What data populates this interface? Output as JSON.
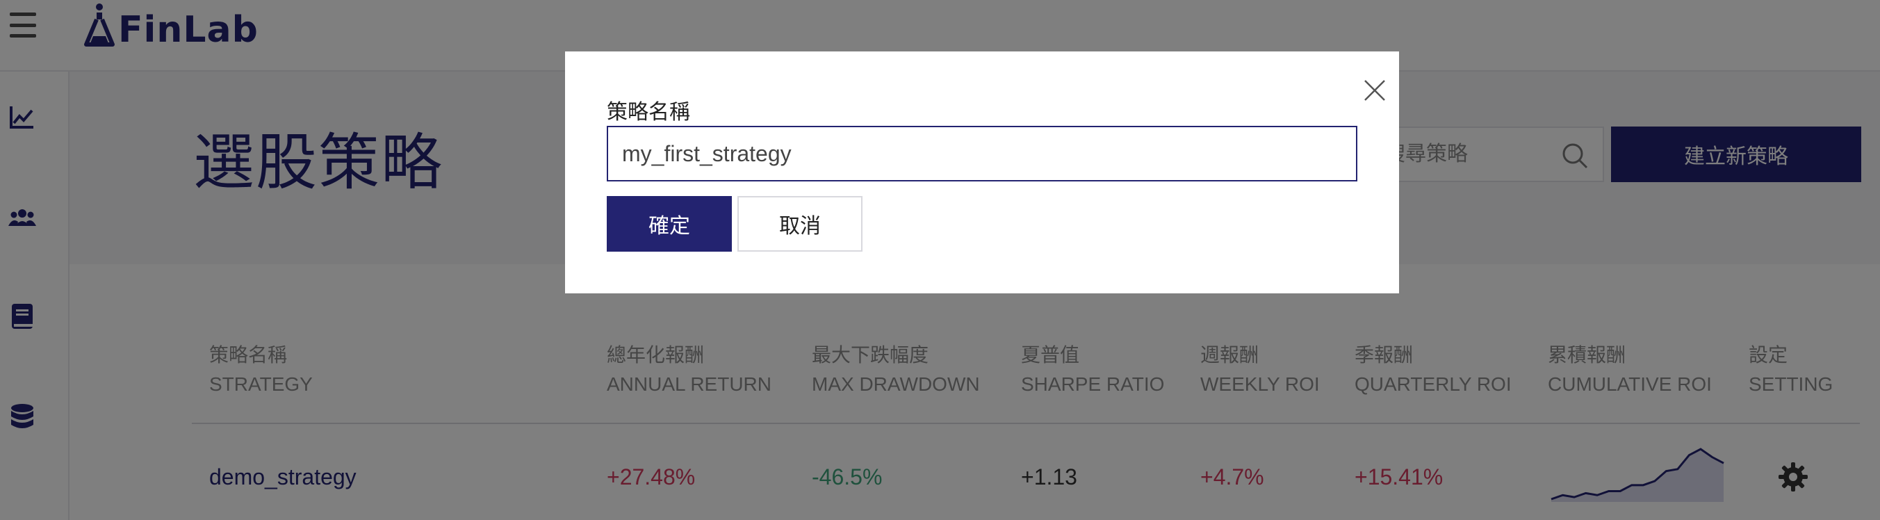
{
  "app": {
    "logo_text": "FinLab"
  },
  "colors": {
    "brand": "#232370",
    "positive": "#d23a5e",
    "negative": "#3fa37a",
    "overlay": "rgba(0,0,0,0.5)"
  },
  "sidebar": {
    "items": [
      {
        "icon": "chart-line-icon"
      },
      {
        "icon": "users-icon"
      },
      {
        "icon": "book-icon"
      },
      {
        "icon": "database-icon"
      }
    ]
  },
  "page": {
    "title": "選股策略",
    "search_placeholder": "搜尋策略",
    "new_strategy_label": "建立新策略"
  },
  "table": {
    "columns": [
      {
        "zh": "策略名稱",
        "en": "STRATEGY"
      },
      {
        "zh": "總年化報酬",
        "en": "ANNUAL RETURN"
      },
      {
        "zh": "最大下跌幅度",
        "en": "MAX DRAWDOWN"
      },
      {
        "zh": "夏普值",
        "en": "SHARPE RATIO"
      },
      {
        "zh": "週報酬",
        "en": "WEEKLY ROI"
      },
      {
        "zh": "季報酬",
        "en": "QUARTERLY ROI"
      },
      {
        "zh": "累積報酬",
        "en": "CUMULATIVE ROI"
      },
      {
        "zh": "設定",
        "en": "SETTING"
      }
    ],
    "rows": [
      {
        "name": "demo_strategy",
        "annual_return": "+27.48%",
        "max_drawdown": "-46.5%",
        "sharpe": "+1.13",
        "weekly_roi": "+4.7%",
        "quarterly_roi": "+15.41%",
        "cumulative_series": [
          0,
          2,
          1,
          3,
          2,
          4,
          4,
          7,
          7,
          9,
          14,
          15,
          22,
          25,
          21,
          18
        ]
      }
    ]
  },
  "modal": {
    "label": "策略名稱",
    "input_value": "my_first_strategy",
    "confirm_label": "確定",
    "cancel_label": "取消"
  }
}
